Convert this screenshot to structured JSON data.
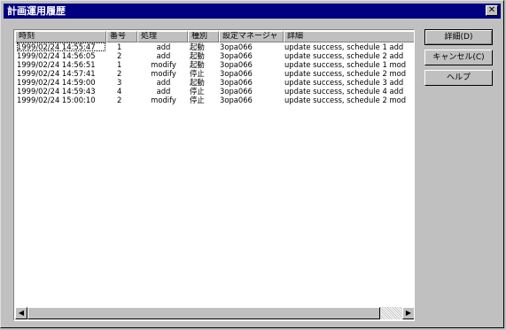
{
  "window": {
    "title": "計画運用履歴",
    "close_symbol": "✕"
  },
  "list": {
    "columns": [
      "時刻",
      "番号",
      "処理",
      "種別",
      "設定マネージャ",
      "詳細"
    ],
    "rows": [
      [
        "1999/02/24 14:55:47",
        "1",
        "add",
        "起動",
        "3opa066",
        "update success, schedule 1 add"
      ],
      [
        "1999/02/24 14:56:05",
        "2",
        "add",
        "起動",
        "3opa066",
        "update success, schedule 2 add"
      ],
      [
        "1999/02/24 14:56:51",
        "1",
        "modify",
        "起動",
        "3opa066",
        "update success, schedule 1 mod"
      ],
      [
        "1999/02/24 14:57:41",
        "2",
        "modify",
        "停止",
        "3opa066",
        "update success, schedule 2 mod"
      ],
      [
        "1999/02/24 14:59:00",
        "3",
        "add",
        "起動",
        "3opa066",
        "update success, schedule 3 add"
      ],
      [
        "1999/02/24 14:59:43",
        "4",
        "add",
        "停止",
        "3opa066",
        "update success, schedule 4 add"
      ],
      [
        "1999/02/24 15:00:10",
        "2",
        "modify",
        "停止",
        "3opa066",
        "update success, schedule 2 mod"
      ]
    ]
  },
  "scrollbar": {
    "left_arrow": "◀",
    "right_arrow": "▶"
  },
  "buttons": {
    "detail": "詳細(D)",
    "cancel": "キャンセル(C)",
    "help": "ヘルプ"
  }
}
